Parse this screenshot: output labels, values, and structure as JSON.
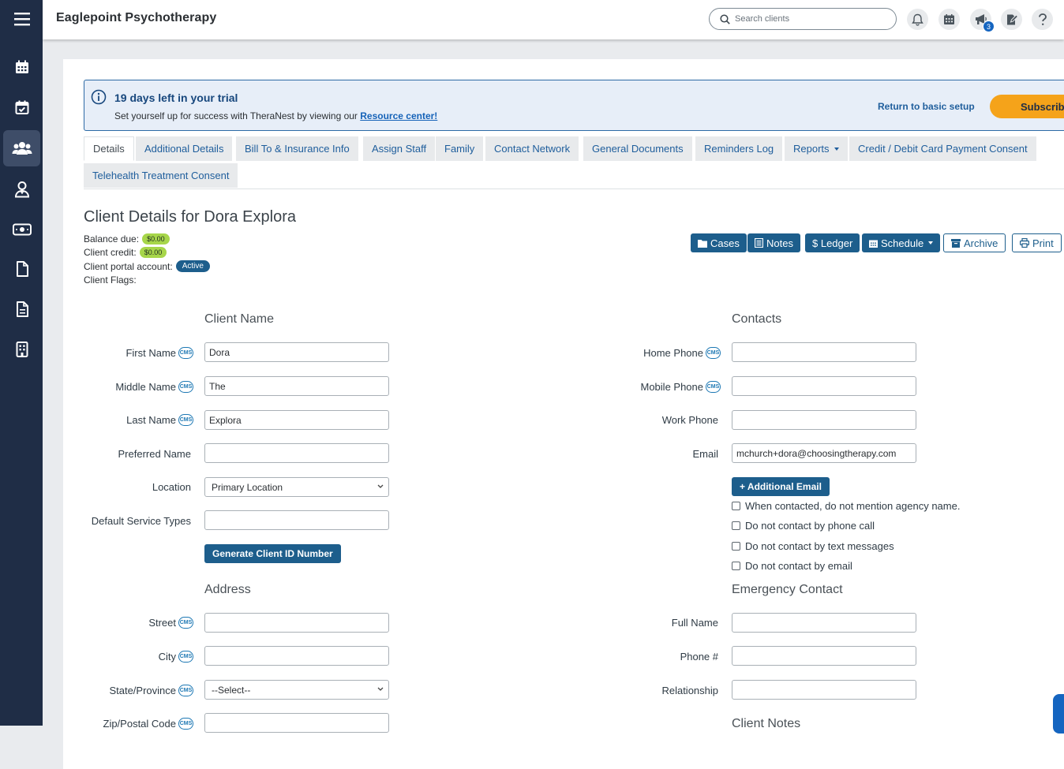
{
  "app": {
    "title": "Eaglepoint Psychotherapy"
  },
  "topbar": {
    "search_placeholder": "Search clients",
    "notifications_badge": "3"
  },
  "sidebar": {
    "items": [
      {
        "name": "menu-icon"
      },
      {
        "name": "calendar-icon"
      },
      {
        "name": "calendar-check-icon"
      },
      {
        "name": "clients-icon",
        "active": true
      },
      {
        "name": "staff-icon"
      },
      {
        "name": "billing-icon"
      },
      {
        "name": "document-icon"
      },
      {
        "name": "notes-icon"
      },
      {
        "name": "building-icon"
      }
    ]
  },
  "trial": {
    "title": "19 days left in your trial",
    "text": "Set yourself up for success with TheraNest by viewing our ",
    "link": "Resource center!",
    "return_link": "Return to basic setup",
    "subscribe": "Subscribe"
  },
  "tabs": [
    "Details",
    "Additional Details",
    "Bill To & Insurance Info",
    "Assign Staff",
    "Family",
    "Contact Network",
    "General Documents",
    "Reminders Log",
    "Reports",
    "Credit / Debit Card Payment Consent",
    "Telehealth Treatment Consent"
  ],
  "client": {
    "page_title": "Client Details for Dora Explora",
    "balance_label": "Balance due:",
    "balance_value": "$0.00",
    "credit_label": "Client credit:",
    "credit_value": "$0.00",
    "portal_label": "Client portal account:",
    "portal_status": "Active",
    "flags_label": "Client Flags:"
  },
  "actions": {
    "cases": "Cases",
    "notes": "Notes",
    "ledger": "$ Ledger",
    "schedule": "Schedule",
    "archive": "Archive",
    "print": "Print"
  },
  "client_name": {
    "heading": "Client Name",
    "first_name_label": "First Name",
    "first_name_value": "Dora",
    "middle_name_label": "Middle Name",
    "middle_name_value": "The",
    "last_name_label": "Last Name",
    "last_name_value": "Explora",
    "preferred_name_label": "Preferred Name",
    "preferred_name_value": "",
    "location_label": "Location",
    "location_value": "Primary Location",
    "service_types_label": "Default Service Types",
    "generate_button": "Generate Client ID Number"
  },
  "address": {
    "heading": "Address",
    "street_label": "Street",
    "city_label": "City",
    "state_label": "State/Province",
    "state_value": "--Select--",
    "zip_label": "Zip/Postal Code"
  },
  "contacts": {
    "heading": "Contacts",
    "home_phone_label": "Home Phone",
    "mobile_phone_label": "Mobile Phone",
    "work_phone_label": "Work Phone",
    "email_label": "Email",
    "email_value": "mchurch+dora@choosingtherapy.com",
    "add_email_button": "+ Additional Email",
    "checkboxes": [
      "When contacted, do not mention agency name.",
      "Do not contact by phone call",
      "Do not contact by text messages",
      "Do not contact by email"
    ]
  },
  "emergency": {
    "heading": "Emergency Contact",
    "full_name_label": "Full Name",
    "phone_label": "Phone #",
    "relationship_label": "Relationship"
  },
  "notes": {
    "heading": "Client Notes"
  },
  "cms_badge": "CMS"
}
